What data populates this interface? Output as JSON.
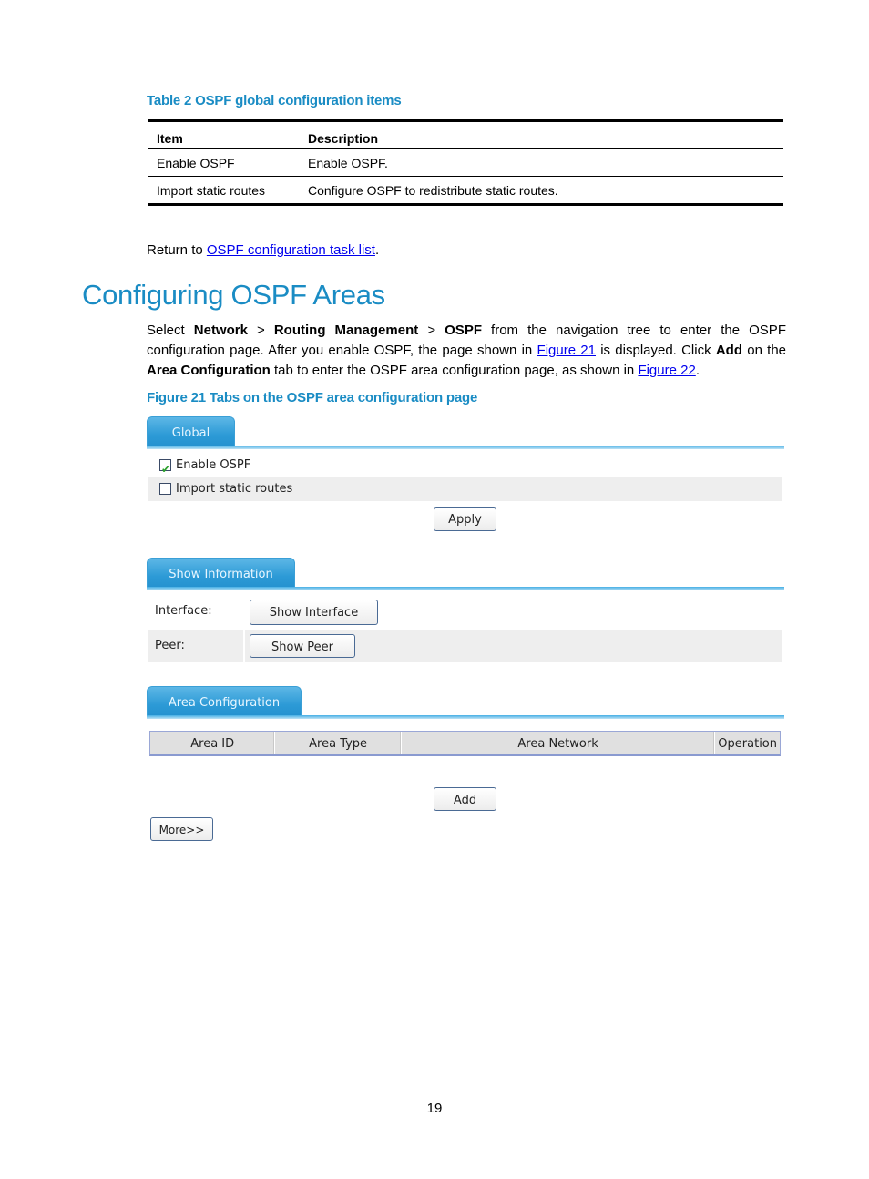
{
  "table_caption": "Table 2 OSPF global configuration items",
  "spec_table": {
    "headers": [
      "Item",
      "Description"
    ],
    "rows": [
      [
        "Enable OSPF",
        "Enable OSPF."
      ],
      [
        "Import static routes",
        "Configure OSPF to redistribute static routes."
      ]
    ]
  },
  "return_text": {
    "prefix": "Return to ",
    "link": "OSPF configuration task list",
    "suffix": "."
  },
  "section_title": "Configuring OSPF Areas",
  "paragraph": {
    "p1": "Select ",
    "b1": "Network",
    "p2": " > ",
    "b2": "Routing Management",
    "p3": " > ",
    "b3": "OSPF",
    "p4": " from the navigation tree to enter the OSPF configuration page. After you enable OSPF, the page shown in ",
    "link1": "Figure 21",
    "p5": " is displayed. Click ",
    "b4": "Add",
    "p6": " on the ",
    "b5": "Area Configuration",
    "p7": " tab to enter the OSPF area configuration page, as shown in ",
    "link2": "Figure 22",
    "p8": "."
  },
  "figure_caption": "Figure 21 Tabs on the OSPF area configuration page",
  "figure": {
    "global_tab": {
      "label": "Global",
      "enable_ospf": {
        "label": "Enable OSPF",
        "checked": true
      },
      "import_static": {
        "label": "Import static routes",
        "checked": false
      },
      "apply_label": "Apply"
    },
    "show_info_tab": {
      "label": "Show Information",
      "interface_label": "Interface:",
      "show_interface_label": "Show Interface",
      "peer_label": "Peer:",
      "show_peer_label": "Show Peer"
    },
    "area_tab": {
      "label": "Area Configuration",
      "columns": [
        "Area ID",
        "Area Type",
        "Area Network",
        "Operation"
      ],
      "add_label": "Add",
      "more_label": "More>>"
    }
  },
  "page_number": "19",
  "colors": {
    "accent": "#1a8cc4",
    "tab": "#2c9ad6",
    "link": "#0000ee"
  }
}
